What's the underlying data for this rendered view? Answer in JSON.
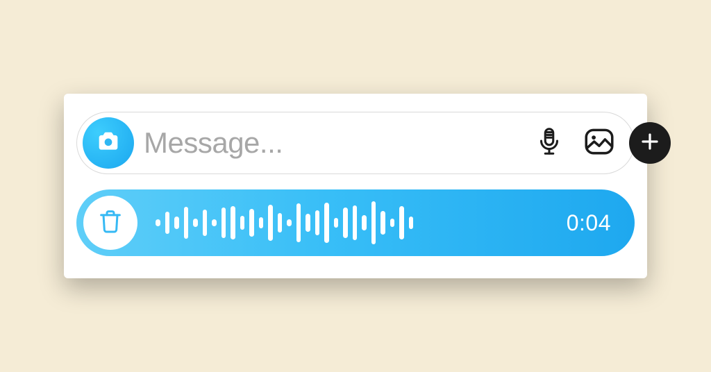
{
  "composer": {
    "placeholder": "Message..."
  },
  "voice": {
    "duration": "0:04",
    "waveform": [
      10,
      32,
      18,
      46,
      12,
      38,
      10,
      44,
      48,
      20,
      40,
      16,
      52,
      28,
      10,
      56,
      26,
      36,
      58,
      14,
      44,
      50,
      22,
      62,
      34,
      12,
      48,
      18
    ]
  },
  "colors": {
    "page_bg": "#f5ecd6",
    "card_bg": "#ffffff",
    "border": "#d9d9d9",
    "placeholder": "#a7a7a7",
    "accent_gradient_start": "#5fcef8",
    "accent_gradient_end": "#1ea8ef",
    "plus_bg": "#1c1c1c"
  }
}
